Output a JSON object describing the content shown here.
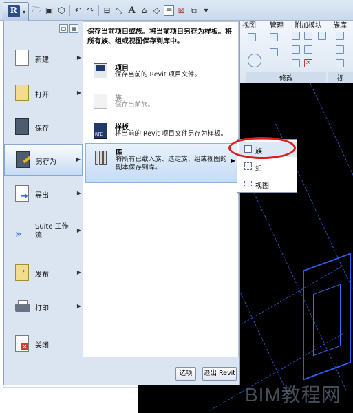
{
  "qat": {
    "app_button_letter": "R",
    "icons": [
      "open-folder-icon",
      "save-icon",
      "sync-icon",
      "undo-icon",
      "redo-icon",
      "measure-icon",
      "dimension-icon",
      "text-icon",
      "3d-view-icon",
      "tag-icon",
      "thin-lines-icon",
      "close-inactive-icon",
      "switch-windows-icon",
      "customize-icon"
    ],
    "text_tool": "A"
  },
  "ribbon": {
    "tabs": [
      "视图",
      "管理",
      "附加模块",
      "族库"
    ],
    "panels": [
      "修改",
      "视"
    ]
  },
  "menu": {
    "items": [
      {
        "label": "新建",
        "has_submenu": true
      },
      {
        "label": "打开",
        "has_submenu": true
      },
      {
        "label": "保存",
        "has_submenu": false
      },
      {
        "label": "另存为",
        "has_submenu": true
      },
      {
        "label": "导出",
        "has_submenu": true
      },
      {
        "label": "Suite 工作流",
        "has_submenu": true
      },
      {
        "label": "发布",
        "has_submenu": true
      },
      {
        "label": "打印",
        "has_submenu": true
      },
      {
        "label": "关闭",
        "has_submenu": false
      }
    ],
    "header": "保存当前项目或族。将当前项目另存为样板。将所有族、组或视图保存到库中。",
    "subitems": [
      {
        "title": "项目",
        "desc": "保存当前的 Revit 项目文件。"
      },
      {
        "title": "族",
        "desc": "保存当前族。"
      },
      {
        "title": "样板",
        "desc": "将当前的 Revit 项目文件另存为样板。"
      },
      {
        "title": "库",
        "desc": "将所有已载入族、选定族、组或视图的副本保存到库。"
      }
    ],
    "options_button": "选项",
    "exit_button": "退出 Revit"
  },
  "flyout": {
    "items": [
      "族",
      "组",
      "视图"
    ]
  },
  "watermark": "BIM教程网"
}
